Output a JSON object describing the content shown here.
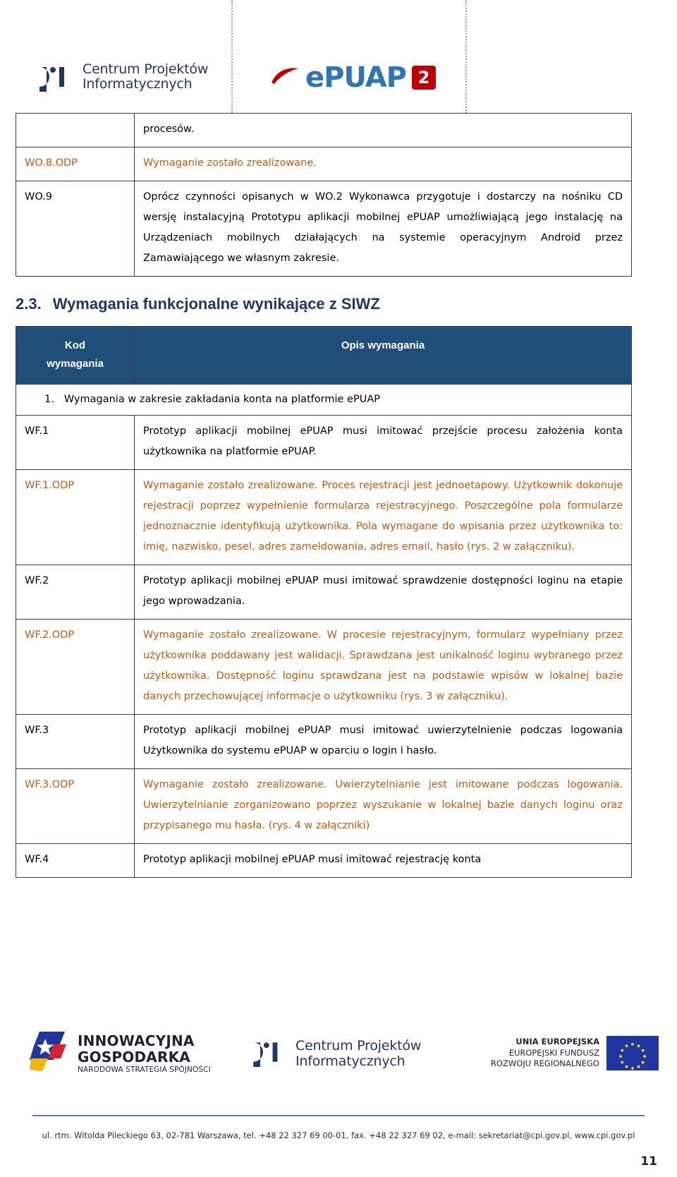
{
  "header": {
    "cpi_logo": {
      "mark": "cpi-monogram",
      "line1": "Centrum Projektów",
      "line2": "Informatycznych"
    },
    "epuap_logo": {
      "word": "ePUAP",
      "badge": "2"
    }
  },
  "top_table": {
    "rows": [
      {
        "code": "",
        "desc": "procesów.",
        "odp": false
      },
      {
        "code": "WO.8.ODP",
        "desc": "Wymaganie zostało zrealizowane.",
        "odp": true
      },
      {
        "code": "WO.9",
        "desc": "Oprócz czynności opisanych w WO.2 Wykonawca przygotuje i dostarczy na nośniku CD wersję instalacyjną Prototypu aplikacji mobilnej ePUAP umożliwiającą jego instalację na Urządzeniach mobilnych działających na systemie operacyjnym Android przez Zamawiającego we własnym zakresie.",
        "odp": false
      }
    ]
  },
  "section": {
    "number": "2.3.",
    "title": "Wymagania funkcjonalne wynikające z SIWZ"
  },
  "req_table": {
    "headers": {
      "code": "Kod\nwymagania",
      "code_line1": "Kod",
      "code_line2": "wymagania",
      "desc": "Opis wymagania"
    },
    "group": {
      "number": "1.",
      "label": "Wymagania w zakresie zakładania konta na platformie ePUAP"
    },
    "rows": [
      {
        "code": "WF.1",
        "desc": "Prototyp aplikacji mobilnej ePUAP musi imitować przejście procesu założenia konta użytkownika na platformie ePUAP.",
        "odp": false
      },
      {
        "code": "WF.1.ODP",
        "desc": "Wymaganie zostało zrealizowane. Proces rejestracji jest jednoetapowy. Użytkownik dokonuje rejestracji poprzez wypełnienie formularza rejestracyjnego. Poszczególne pola formularze jednoznacznie identyfikują użytkownika. Pola wymagane do wpisania przez użytkownika to: imię, nazwisko, pesel, adres zameldowania, adres email, hasło (rys. 2 w załączniku).",
        "odp": true
      },
      {
        "code": "WF.2",
        "desc": "Prototyp aplikacji mobilnej ePUAP musi imitować sprawdzenie dostępności loginu na etapie jego wprowadzania.",
        "odp": false
      },
      {
        "code": "WF.2.ODP",
        "desc": "Wymaganie zostało zrealizowane. W procesie rejestracyjnym, formularz wypełniany przez użytkownika poddawany jest walidacji. Sprawdzana jest unikalność loginu wybranego przez użytkownika. Dostępność loginu sprawdzana jest na podstawie wpisów w lokalnej bazie danych przechowującej informacje o użytkowniku (rys. 3 w załączniku).",
        "odp": true
      },
      {
        "code": "WF.3",
        "desc": "Prototyp aplikacji mobilnej ePUAP musi imitować uwierzytelnienie podczas logowania Użytkownika do systemu ePUAP w oparciu o login i hasło.",
        "odp": false
      },
      {
        "code": "WF.3.ODP",
        "desc": "Wymaganie zostało zrealizowane. Uwierzytelnianie jest imitowane podczas logowania. Uwierzytelnianie zorganizowano poprzez wyszukanie w lokalnej bazie danych loginu oraz przypisanego mu hasła. (rys. 4 w załączniki)",
        "odp": true
      },
      {
        "code": "WF.4",
        "desc": "Prototyp aplikacji mobilnej ePUAP musi imitować rejestrację konta",
        "odp": false
      }
    ]
  },
  "footer": {
    "innowacyjna": {
      "line1": "INNOWACYJNA",
      "line2": "GOSPODARKA",
      "line3": "NARODOWA STRATEGIA SPÓJNOŚCI"
    },
    "cpi": {
      "line1": "Centrum Projektów",
      "line2": "Informatycznych"
    },
    "ue": {
      "line1": "UNIA EUROPEJSKA",
      "line2": "EUROPEJSKI FUNDUSZ",
      "line3": "ROZWOJU REGIONALNEGO"
    },
    "address": "ul. rtm. Witolda Pileckiego 63, 02-781 Warszawa, tel. +48 22 327 69 00-01, fax. +48 22 327 69 02, e-mail: sekretariat@cpi.gov.pl, www.cpi.gov.pl",
    "page_number": "11"
  },
  "colors": {
    "heading_blue": "#1f3864",
    "table_header_blue": "#1f4e79",
    "border_blue": "#2f3a75",
    "odp_orange": "#c55a11",
    "epuap_blue": "#2e75b6",
    "epuap_red": "#c00000"
  }
}
